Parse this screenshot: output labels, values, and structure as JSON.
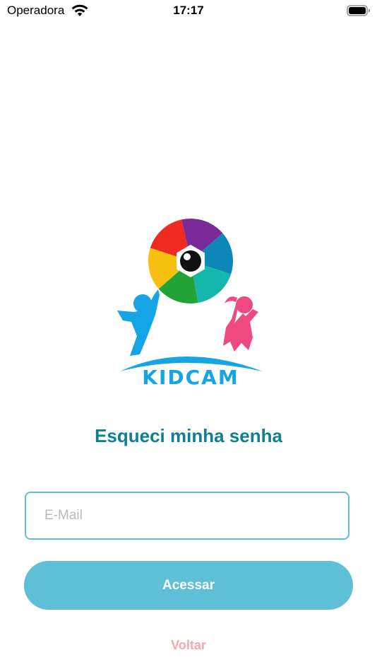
{
  "status_bar": {
    "carrier": "Operadora",
    "time": "17:17",
    "wifi_icon": "wifi-icon",
    "battery_icon": "battery-icon"
  },
  "logo": {
    "text": "KIDCAM",
    "icon": "camera-aperture-logo"
  },
  "title": "Esqueci minha senha",
  "email_field": {
    "value": "",
    "placeholder": "E-Mail"
  },
  "submit_button": {
    "label": "Acessar"
  },
  "back_link": {
    "label": "Voltar"
  },
  "colors": {
    "title": "#0f7f94",
    "field_border": "#5ebfd4",
    "button_background": "#5ebfd6",
    "back_link": "#f7a6b4"
  }
}
